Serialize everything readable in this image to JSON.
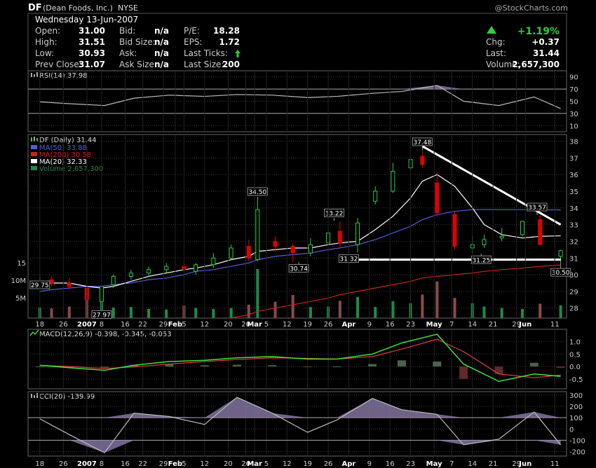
{
  "header": {
    "symbol": "DF",
    "company": "(Dean Foods, Inc.)",
    "exchange": "NYSE",
    "brand": "@StockCharts.com",
    "date": "Wednesday 13-Jun-2007"
  },
  "quote": {
    "labels": {
      "open": "Open:",
      "high": "High:",
      "low": "Low:",
      "prev_close": "Prev Close:",
      "bid": "Bid:",
      "bid_size": "Bid Size:",
      "ask": "Ask:",
      "ask_size": "Ask Size:",
      "pe": "P/E:",
      "eps": "EPS:",
      "last_ticks": "Last Ticks:",
      "last_size": "Last Size:",
      "chg": "Chg:",
      "last": "Last:",
      "volume": "Volume:"
    },
    "open": "31.00",
    "high": "31.51",
    "low": "30.93",
    "prev_close": "31.07",
    "bid": "n/a",
    "bid_size": "n/a",
    "ask": "n/a",
    "ask_size": "n/a",
    "pe": "18.28",
    "eps": "1.72",
    "last_size": "200",
    "pct_change": "+1.19%",
    "chg": "+0.37",
    "last": "31.44",
    "volume": "2,657,300"
  },
  "colors": {
    "up": "#2ecc40",
    "down": "#e00000",
    "ma50": "#5a5adc",
    "ma200": "#d02020",
    "ma20": "#ffffff",
    "vol_up": "#1e8a4a",
    "vol_down": "#8a4a4a",
    "indicator_fill": "#8a7aa8",
    "grid": "#3a3a3a",
    "text": "#cccccc"
  },
  "icons": {
    "rsi": "rsi-bars-icon",
    "price": "candlestick-icon",
    "macd": "macd-line-icon",
    "cci": "cci-bars-icon"
  },
  "chart_data": [
    {
      "type": "line",
      "name": "RSI panel",
      "title": "RSI(14) 37.98",
      "ylim": [
        0,
        100
      ],
      "yticks": [
        10,
        30,
        50,
        70,
        90
      ],
      "reference_lines": [
        70,
        30
      ],
      "x": [
        "2006-12-18",
        "2006-12-28",
        "2007-01-09",
        "2007-01-19",
        "2007-01-31",
        "2007-02-12",
        "2007-02-23",
        "2007-03-07",
        "2007-03-19",
        "2007-03-29",
        "2007-04-10",
        "2007-04-20",
        "2007-05-02",
        "2007-05-11",
        "2007-05-23",
        "2007-06-04",
        "2007-06-13"
      ],
      "values": [
        49,
        46,
        43,
        55,
        60,
        58,
        61,
        60,
        56,
        58,
        63,
        66,
        76,
        50,
        43,
        57,
        38
      ]
    },
    {
      "type": "candlestick",
      "name": "Price panel",
      "title": "DF (Daily) 31.44",
      "legend": [
        {
          "label": "MA(50) 33.88",
          "color": "#5a5adc"
        },
        {
          "label": "MA(200) 30.58",
          "color": "#d02020"
        },
        {
          "label": "MA(20) 32.33",
          "color": "#ffffff"
        },
        {
          "label": "Volume 2,657,300",
          "color": "#1e8a4a"
        }
      ],
      "ylim": [
        27.4,
        38.4
      ],
      "yticks": [
        28,
        29,
        30,
        31,
        32,
        33,
        34,
        35,
        36,
        37,
        38
      ],
      "volume_ticks": [
        "5M",
        "10M",
        "15"
      ],
      "x_ticks": [
        "18",
        "26",
        "2007",
        "8",
        "16",
        "22",
        "29",
        "Feb",
        "5",
        "12",
        "20",
        "26",
        "Mar",
        "5",
        "12",
        "19",
        "26",
        "Apr",
        "9",
        "16",
        "23",
        "May",
        "7",
        "14",
        "21",
        "29",
        "Jun",
        "11"
      ],
      "annotations": [
        {
          "date": "2006-12-18",
          "value": 29.75,
          "label": "29.75"
        },
        {
          "date": "2007-01-08",
          "value": 27.97,
          "label": "27.97"
        },
        {
          "date": "2007-03-02",
          "value": 34.5,
          "label": "34.50"
        },
        {
          "date": "2007-03-16",
          "value": 30.74,
          "label": "30.74"
        },
        {
          "date": "2007-03-28",
          "value": 33.22,
          "label": "33.22"
        },
        {
          "date": "2007-04-02",
          "value": 31.32,
          "label": "31.32"
        },
        {
          "date": "2007-04-27",
          "value": 37.48,
          "label": "37.48"
        },
        {
          "date": "2007-05-17",
          "value": 31.25,
          "label": "31.25"
        },
        {
          "date": "2007-06-05",
          "value": 33.57,
          "label": "33.57"
        },
        {
          "date": "2007-06-13",
          "value": 30.5,
          "label": "30.50"
        }
      ],
      "trendlines": [
        {
          "from": [
            "2007-04-27",
            37.7
          ],
          "to": [
            "2007-06-13",
            33.0
          ]
        },
        {
          "from": [
            "2007-04-02",
            30.9
          ],
          "to": [
            "2007-06-13",
            30.9
          ]
        }
      ],
      "ohlc": {
        "dates": [
          "2006-12-18",
          "2006-12-22",
          "2006-12-28",
          "2007-01-03",
          "2007-01-08",
          "2007-01-12",
          "2007-01-18",
          "2007-01-24",
          "2007-01-30",
          "2007-02-05",
          "2007-02-09",
          "2007-02-15",
          "2007-02-21",
          "2007-02-27",
          "2007-03-02",
          "2007-03-08",
          "2007-03-14",
          "2007-03-20",
          "2007-03-26",
          "2007-03-30",
          "2007-04-05",
          "2007-04-11",
          "2007-04-17",
          "2007-04-23",
          "2007-04-27",
          "2007-05-02",
          "2007-05-08",
          "2007-05-14",
          "2007-05-18",
          "2007-05-24",
          "2007-05-31",
          "2007-06-06",
          "2007-06-13"
        ],
        "open": [
          29.5,
          29.7,
          29.5,
          29.2,
          28.4,
          29.4,
          29.9,
          30.1,
          30.3,
          30.5,
          30.2,
          30.6,
          31.0,
          31.7,
          30.9,
          32.0,
          31.7,
          31.3,
          31.9,
          32.6,
          31.8,
          34.4,
          35.0,
          36.4,
          37.1,
          35.5,
          33.6,
          31.6,
          31.8,
          32.2,
          32.4,
          33.3,
          31.1
        ],
        "high": [
          29.9,
          29.9,
          29.8,
          29.4,
          29.3,
          30.0,
          30.3,
          30.5,
          30.7,
          30.8,
          30.7,
          31.3,
          31.8,
          32.1,
          34.5,
          32.3,
          31.9,
          32.2,
          32.7,
          33.2,
          33.4,
          35.3,
          36.7,
          37.0,
          37.5,
          36.1,
          33.8,
          32.3,
          32.4,
          32.8,
          33.2,
          33.6,
          31.5
        ],
        "low": [
          29.2,
          29.3,
          29.1,
          28.0,
          27.97,
          29.2,
          29.7,
          29.9,
          30.1,
          29.9,
          30.0,
          30.4,
          30.9,
          30.8,
          30.8,
          31.4,
          30.74,
          31.1,
          31.8,
          31.6,
          31.32,
          34.2,
          34.9,
          36.2,
          36.4,
          33.5,
          31.5,
          31.25,
          31.6,
          32.0,
          32.3,
          31.9,
          30.5
        ],
        "close": [
          29.6,
          29.5,
          29.3,
          28.5,
          29.3,
          29.9,
          30.1,
          30.3,
          30.5,
          30.3,
          30.6,
          31.0,
          31.6,
          31.0,
          33.9,
          31.7,
          31.3,
          31.8,
          32.5,
          31.9,
          33.1,
          35.0,
          36.2,
          36.9,
          36.6,
          33.7,
          31.7,
          31.8,
          32.1,
          32.3,
          33.2,
          31.8,
          31.44
        ],
        "volume_m": [
          2.2,
          2.0,
          2.4,
          3.8,
          4.6,
          2.2,
          2.3,
          1.9,
          1.8,
          2.6,
          2.1,
          1.9,
          2.1,
          2.8,
          10.2,
          3.4,
          4.8,
          2.3,
          2.4,
          3.6,
          4.4,
          2.3,
          3.5,
          3.1,
          4.9,
          7.6,
          4.2,
          3.1,
          2.4,
          2.1,
          1.9,
          3.0,
          2.66
        ]
      },
      "ma20": [
        29.4,
        29.5,
        29.5,
        29.3,
        29.2,
        29.3,
        29.6,
        29.9,
        30.1,
        30.3,
        30.4,
        30.6,
        30.9,
        31.1,
        31.4,
        31.5,
        31.6,
        31.6,
        31.8,
        31.9,
        32.0,
        32.7,
        33.5,
        34.6,
        35.6,
        36.0,
        35.3,
        34.0,
        33.0,
        32.4,
        32.2,
        32.3,
        32.33
      ],
      "ma50": [
        29.0,
        29.1,
        29.2,
        29.3,
        29.3,
        29.4,
        29.5,
        29.7,
        29.8,
        30.0,
        30.2,
        30.3,
        30.5,
        30.7,
        30.9,
        31.1,
        31.2,
        31.3,
        31.5,
        31.6,
        31.8,
        32.1,
        32.5,
        32.9,
        33.3,
        33.6,
        33.8,
        33.9,
        33.9,
        33.9,
        33.9,
        33.9,
        33.88
      ],
      "ma200": [
        null,
        null,
        null,
        null,
        null,
        null,
        null,
        null,
        null,
        null,
        null,
        null,
        27.4,
        27.6,
        27.8,
        28.0,
        28.2,
        28.4,
        28.6,
        28.8,
        29.0,
        29.2,
        29.4,
        29.6,
        29.8,
        29.9,
        30.0,
        30.1,
        30.2,
        30.3,
        30.4,
        30.5,
        30.58
      ]
    },
    {
      "type": "line",
      "name": "MACD panel",
      "title": "MACD(12,26,9) -0.398, -0.345, -0.053",
      "ylim": [
        -0.9,
        1.5
      ],
      "yticks": [
        -0.5,
        0.0,
        0.5,
        1.0
      ],
      "x": [
        "2006-12-18",
        "2006-12-28",
        "2007-01-09",
        "2007-01-19",
        "2007-01-31",
        "2007-02-12",
        "2007-02-23",
        "2007-03-07",
        "2007-03-19",
        "2007-03-29",
        "2007-04-10",
        "2007-04-20",
        "2007-05-02",
        "2007-05-11",
        "2007-05-23",
        "2007-06-04",
        "2007-06-13"
      ],
      "series": [
        {
          "name": "MACD",
          "values": [
            0.05,
            -0.05,
            -0.15,
            0.05,
            0.2,
            0.25,
            0.35,
            0.4,
            0.3,
            0.3,
            0.5,
            0.95,
            1.3,
            0.1,
            -0.6,
            -0.3,
            -0.398
          ]
        },
        {
          "name": "Signal",
          "values": [
            0.05,
            0.0,
            -0.08,
            -0.02,
            0.1,
            0.2,
            0.28,
            0.35,
            0.33,
            0.3,
            0.4,
            0.7,
            1.1,
            0.6,
            -0.3,
            -0.45,
            -0.345
          ]
        },
        {
          "name": "Histogram",
          "values": [
            0.0,
            -0.05,
            -0.07,
            0.07,
            0.1,
            0.05,
            0.07,
            0.05,
            -0.03,
            0.0,
            0.1,
            0.25,
            0.2,
            -0.5,
            -0.3,
            0.15,
            -0.053
          ]
        }
      ]
    },
    {
      "type": "line",
      "name": "CCI panel",
      "title": "CCI(20) -139.99",
      "ylim": [
        -240,
        330
      ],
      "yticks": [
        -200,
        -100,
        0,
        100,
        200,
        300
      ],
      "reference_lines": [
        100,
        -100
      ],
      "x": [
        "2006-12-18",
        "2006-12-28",
        "2007-01-09",
        "2007-01-19",
        "2007-01-31",
        "2007-02-12",
        "2007-02-23",
        "2007-03-07",
        "2007-03-19",
        "2007-03-29",
        "2007-04-10",
        "2007-04-20",
        "2007-05-02",
        "2007-05-11",
        "2007-05-23",
        "2007-06-04",
        "2007-06-13"
      ],
      "values": [
        90,
        -50,
        -210,
        140,
        110,
        40,
        280,
        140,
        -30,
        80,
        270,
        170,
        130,
        -140,
        -90,
        150,
        -140
      ]
    }
  ]
}
